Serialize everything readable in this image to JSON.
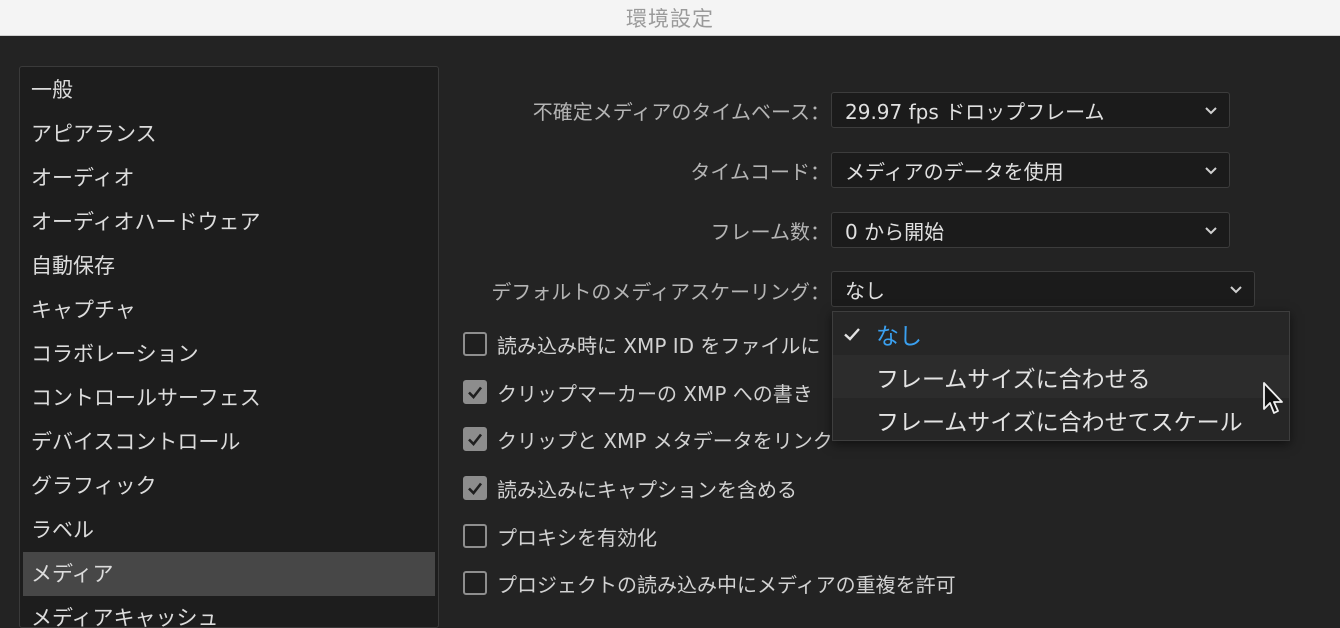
{
  "window": {
    "title": "環境設定"
  },
  "sidebar": {
    "items": [
      {
        "label": "一般"
      },
      {
        "label": "アピアランス"
      },
      {
        "label": "オーディオ"
      },
      {
        "label": "オーディオハードウェア"
      },
      {
        "label": "自動保存"
      },
      {
        "label": "キャプチャ"
      },
      {
        "label": "コラボレーション"
      },
      {
        "label": "コントロールサーフェス"
      },
      {
        "label": "デバイスコントロール"
      },
      {
        "label": "グラフィック"
      },
      {
        "label": "ラベル"
      },
      {
        "label": "メディア",
        "selected": true
      },
      {
        "label": "メディアキャッシュ"
      }
    ]
  },
  "form": {
    "timebase": {
      "label": "不確定メディアのタイムベース：",
      "value": "29.97 fps ドロップフレーム"
    },
    "timecode": {
      "label": "タイムコード：",
      "value": "メディアのデータを使用"
    },
    "frame_count": {
      "label": "フレーム数：",
      "value": "0 から開始"
    },
    "scaling": {
      "label": "デフォルトのメディアスケーリング：",
      "value": "なし"
    }
  },
  "checkboxes": [
    {
      "label": "読み込み時に XMP ID をファイルに",
      "checked": false
    },
    {
      "label": "クリップマーカーの XMP への書き",
      "checked": true
    },
    {
      "label": "クリップと XMP メタデータをリンク",
      "checked": true
    },
    {
      "label": "読み込みにキャプションを含める",
      "checked": true
    },
    {
      "label": "プロキシを有効化",
      "checked": false
    },
    {
      "label": "プロジェクトの読み込み中にメディアの重複を許可",
      "checked": false
    }
  ],
  "dropdown": {
    "options": [
      {
        "label": "なし",
        "selected": true
      },
      {
        "label": "フレームサイズに合わせる",
        "selected": false
      },
      {
        "label": "フレームサイズに合わせてスケール",
        "selected": false
      }
    ]
  },
  "colors": {
    "accent": "#3aa0f0",
    "background": "#232323",
    "sidebar_selected": "#474747"
  },
  "icons": {
    "chevron": "chevron-down-icon",
    "check": "checkmark-icon",
    "cursor": "mouse-pointer-icon"
  }
}
